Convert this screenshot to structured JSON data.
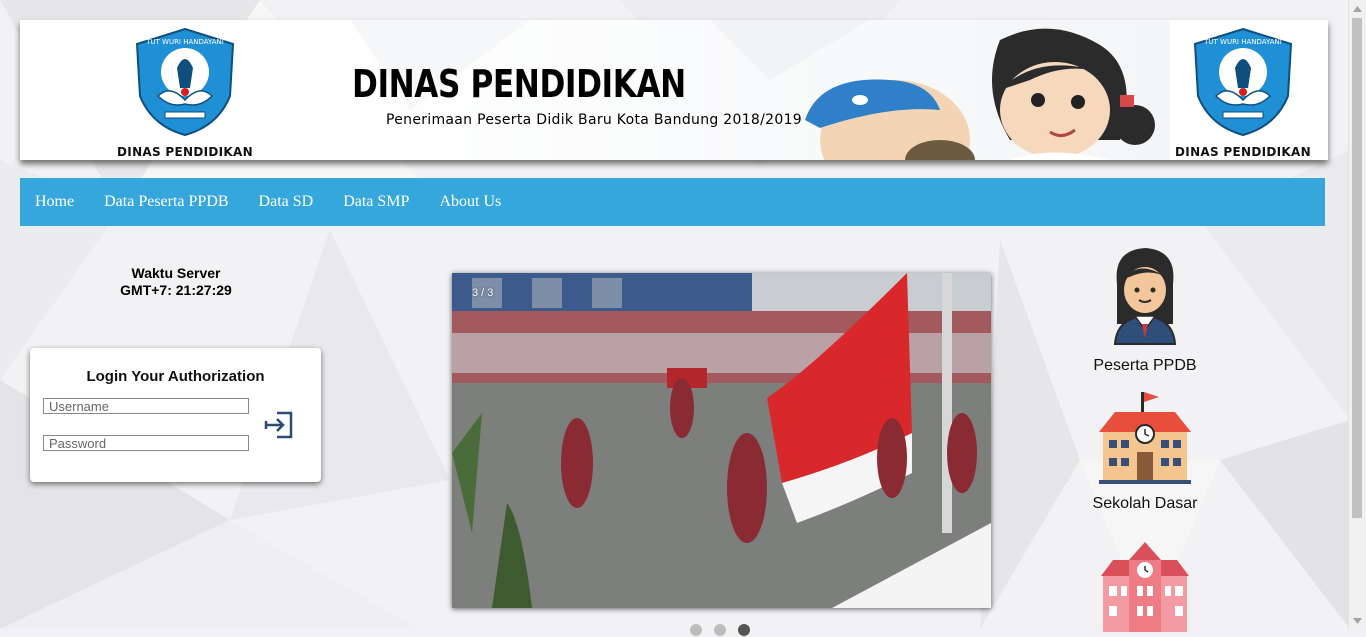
{
  "header": {
    "logo_caption": "DINAS PENDIDIKAN",
    "logo_motto": "TUT WURI HANDAYANI",
    "title": "DINAS PENDIDIKAN",
    "subtitle": "Penerimaan Peserta Didik Baru Kota Bandung 2018/2019"
  },
  "nav": {
    "items": [
      {
        "label": "Home"
      },
      {
        "label": "Data Peserta PPDB"
      },
      {
        "label": "Data SD"
      },
      {
        "label": "Data SMP"
      },
      {
        "label": "About Us"
      }
    ],
    "color": "#35a7dc"
  },
  "server_time": {
    "label": "Waktu Server",
    "value": "GMT+7: 21:27:29"
  },
  "login": {
    "title": "Login Your Authorization",
    "username_placeholder": "Username",
    "password_placeholder": "Password",
    "submit_icon": "login-arrow-icon"
  },
  "carousel": {
    "counter": "3 / 3",
    "slide_count": 3,
    "active_slide": 3
  },
  "side_menu": [
    {
      "label": "Peserta PPDB",
      "icon": "student-icon"
    },
    {
      "label": "Sekolah Dasar",
      "icon": "school-building-icon"
    },
    {
      "label": "",
      "icon": "school-building-pink-icon"
    }
  ]
}
